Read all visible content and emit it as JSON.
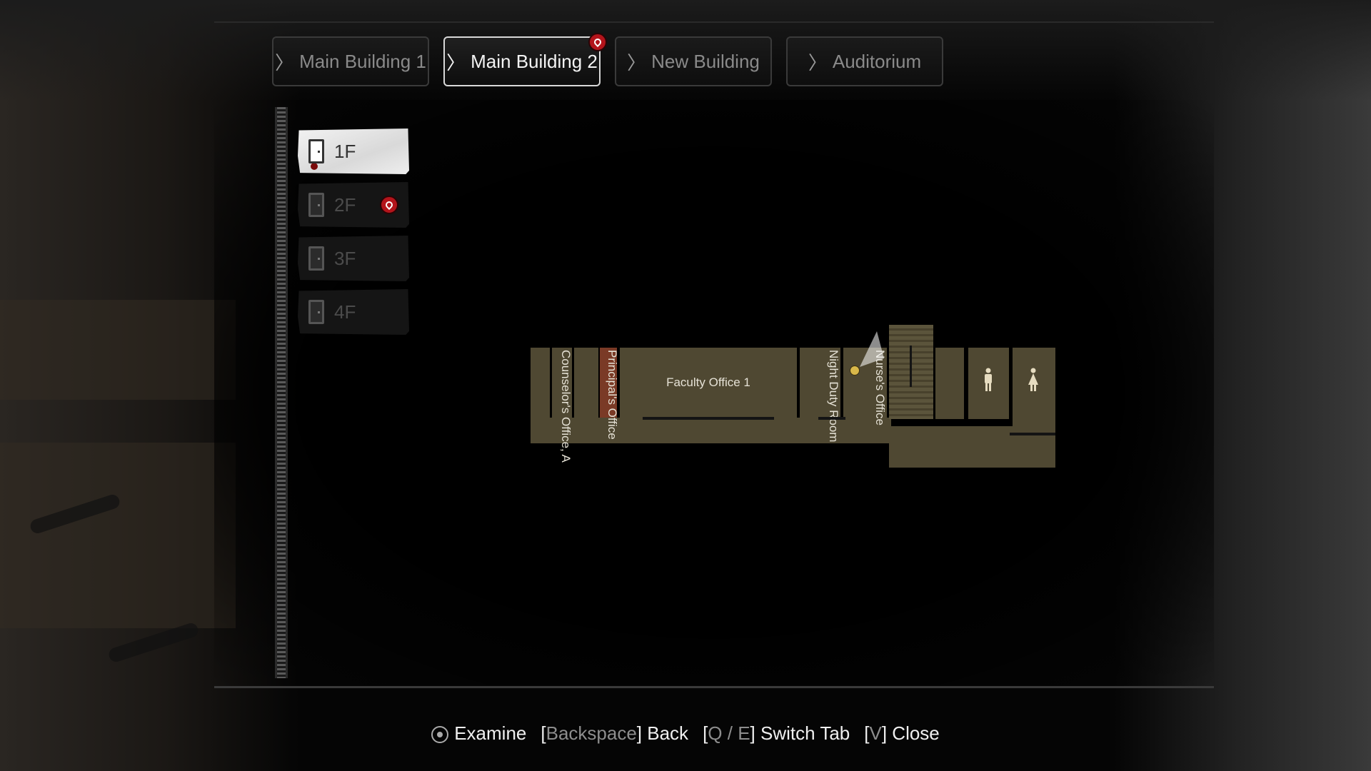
{
  "tabs": [
    {
      "label": "Main Building 1",
      "active": false,
      "pinned": false
    },
    {
      "label": "Main Building 2",
      "active": true,
      "pinned": true
    },
    {
      "label": "New Building",
      "active": false,
      "pinned": false
    },
    {
      "label": "Auditorium",
      "active": false,
      "pinned": false
    }
  ],
  "tab_chevron": "〉",
  "floors": [
    {
      "label": "1F",
      "active": true,
      "pinned": false
    },
    {
      "label": "2F",
      "active": false,
      "pinned": true
    },
    {
      "label": "3F",
      "active": false,
      "pinned": false
    },
    {
      "label": "4F",
      "active": false,
      "pinned": false
    }
  ],
  "map": {
    "rooms": {
      "counselor_office_a": "Counselor's Office, A",
      "principals_office": "Principal's Office",
      "faculty_office_1": "Faculty Office 1",
      "night_duty_room": "Night Duty Room",
      "nurses_office": "Nurse's Office"
    },
    "restroom_icons": [
      "male-restroom-icon",
      "female-restroom-icon"
    ],
    "colors": {
      "room_fill": "#4f4832",
      "highlight_room": "#7a3a26",
      "pin": "#b3141b"
    }
  },
  "controls": {
    "examine": "Examine",
    "back_key": "Backspace",
    "back": "Back",
    "switch_key": "Q / E",
    "switch": "Switch Tab",
    "close_key": "V",
    "close": "Close"
  }
}
